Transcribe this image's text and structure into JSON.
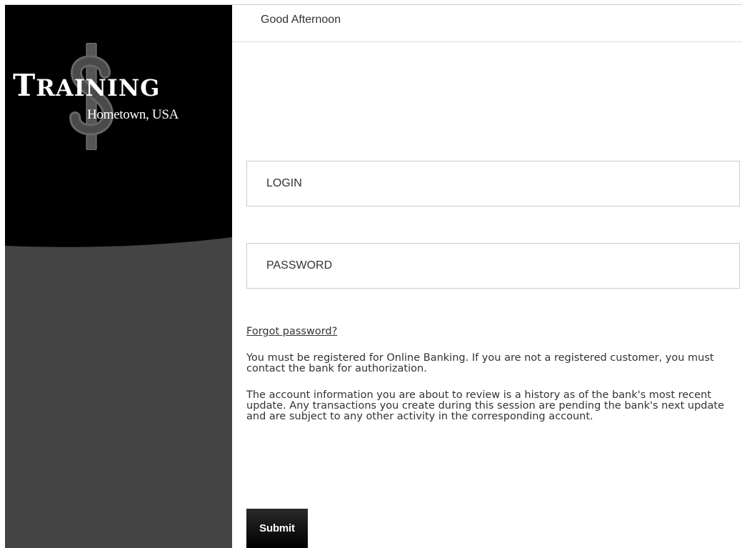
{
  "brand": {
    "name_first": "T",
    "name_rest": "RAINING",
    "subtitle": "Hometown, USA",
    "logo_icon": "dollar-sign-icon"
  },
  "header": {
    "greeting": "Good Afternoon"
  },
  "login_form": {
    "login_placeholder": "LOGIN",
    "password_placeholder": "PASSWORD",
    "forgot_password_link": "Forgot password?",
    "notice_registration": "You must be registered for Online Banking. If you are not a registered customer, you must contact the bank for authorization.",
    "notice_account_info": "The account information you are about to review is a history as of the bank's most recent update. Any transactions you create during this session are pending the bank's next update and are subject to any other activity in the corresponding account.",
    "submit_label": "Submit"
  },
  "colors": {
    "panel_top": "#000000",
    "panel_bottom": "#444444",
    "button": "#111111",
    "text": "#333333"
  }
}
